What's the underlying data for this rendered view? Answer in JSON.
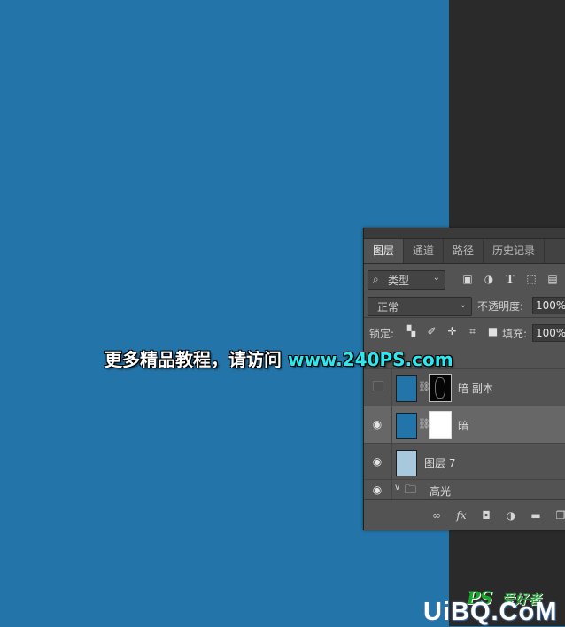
{
  "canvas": {
    "background": "#2374a8"
  },
  "layers_panel": {
    "tabs": [
      {
        "label": "图层",
        "active": true
      },
      {
        "label": "通道",
        "active": false
      },
      {
        "label": "路径",
        "active": false
      },
      {
        "label": "历史记录",
        "active": false
      }
    ],
    "filter": {
      "icon": "search-icon",
      "label": "类型"
    },
    "blend_mode": "正常",
    "opacity_label": "不透明度:",
    "opacity_value": "100%",
    "lock_label": "锁定:",
    "fill_label": "填充:",
    "fill_value": "100%",
    "layers": [
      {
        "name": "暗 副本",
        "visible": false,
        "mask": "black",
        "selected": false
      },
      {
        "name": "暗",
        "visible": true,
        "mask": "white",
        "selected": true
      },
      {
        "name": "图层 7",
        "visible": true,
        "mask": null,
        "selected": false
      }
    ],
    "group": {
      "name": "高光",
      "visible": true,
      "expanded": true
    },
    "bottom_icons": [
      "link-icon",
      "fx-icon",
      "add-mask-icon",
      "adjustment-icon",
      "folder-icon",
      "new-layer-icon"
    ]
  },
  "watermark": {
    "text": "更多精品教程，请访问 ",
    "url": "www.240PS.com"
  },
  "logo": {
    "ps": "PS",
    "cn": "爱好者",
    "site": "UiBQ.CoM"
  }
}
